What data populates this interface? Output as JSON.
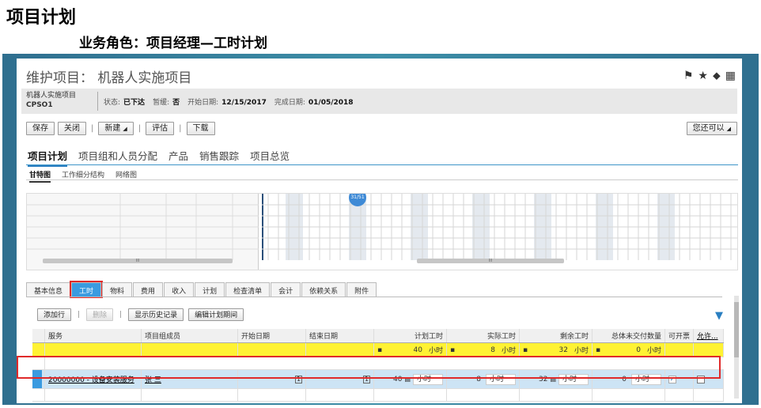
{
  "slide": {
    "title": "项目计划",
    "subtitle": "业务角色：项目经理—工时计划"
  },
  "app": {
    "title": "维护项目： 机器人实施项目",
    "header_icons": [
      "flag-icon",
      "star-icon",
      "tag-icon",
      "export-icon"
    ],
    "info": {
      "name": "机器人实施项目",
      "id": "CPSO1",
      "status_label": "状态:",
      "status_value": "已下达",
      "pause_label": "暂缓:",
      "pause_value": "否",
      "start_label": "开始日期:",
      "start_value": "12/15/2017",
      "end_label": "完成日期:",
      "end_value": "01/05/2018"
    },
    "toolbar": {
      "save": "保存",
      "close": "关闭",
      "new": "新建",
      "evaluate": "评估",
      "download": "下载",
      "more": "您还可以"
    },
    "main_tabs": [
      "项目计划",
      "项目组和人员分配",
      "产品",
      "销售跟踪",
      "项目总览"
    ],
    "sub_tabs": [
      "甘特图",
      "工作细分结构",
      "网络图"
    ],
    "gantt": {
      "marker": "31/51",
      "scroll_grip": "III"
    },
    "detail_tabs": [
      "基本信息",
      "工时",
      "物料",
      "费用",
      "收入",
      "计划",
      "检查清单",
      "会计",
      "依赖关系",
      "附件"
    ],
    "grid_toolbar": {
      "add_row": "添加行",
      "delete": "删除",
      "history": "显示历史记录",
      "edit_period": "编辑计划期间"
    },
    "columns": {
      "service": "服务",
      "member": "项目组成员",
      "start": "开始日期",
      "end": "结束日期",
      "planned": "计划工时",
      "actual": "实际工时",
      "remaining": "剩余工时",
      "open_qty": "总体未交付数量",
      "invoiceable": "可开票",
      "allow": "允许..."
    },
    "totals": {
      "planned": "40",
      "planned_unit": "小时",
      "actual": "8",
      "actual_unit": "小时",
      "remaining": "32",
      "remaining_unit": "小时",
      "open_qty": "0",
      "open_qty_unit": "小时"
    },
    "row": {
      "service": "20000000 - 设备安装服务",
      "member": "张 三",
      "planned": "40",
      "planned_unit": "小时",
      "actual": "8",
      "actual_unit": "小时",
      "remaining": "32",
      "remaining_unit": "小时",
      "open_qty": "0",
      "open_qty_unit": "小时",
      "invoiceable_checked": true,
      "allow_checked": false
    }
  }
}
